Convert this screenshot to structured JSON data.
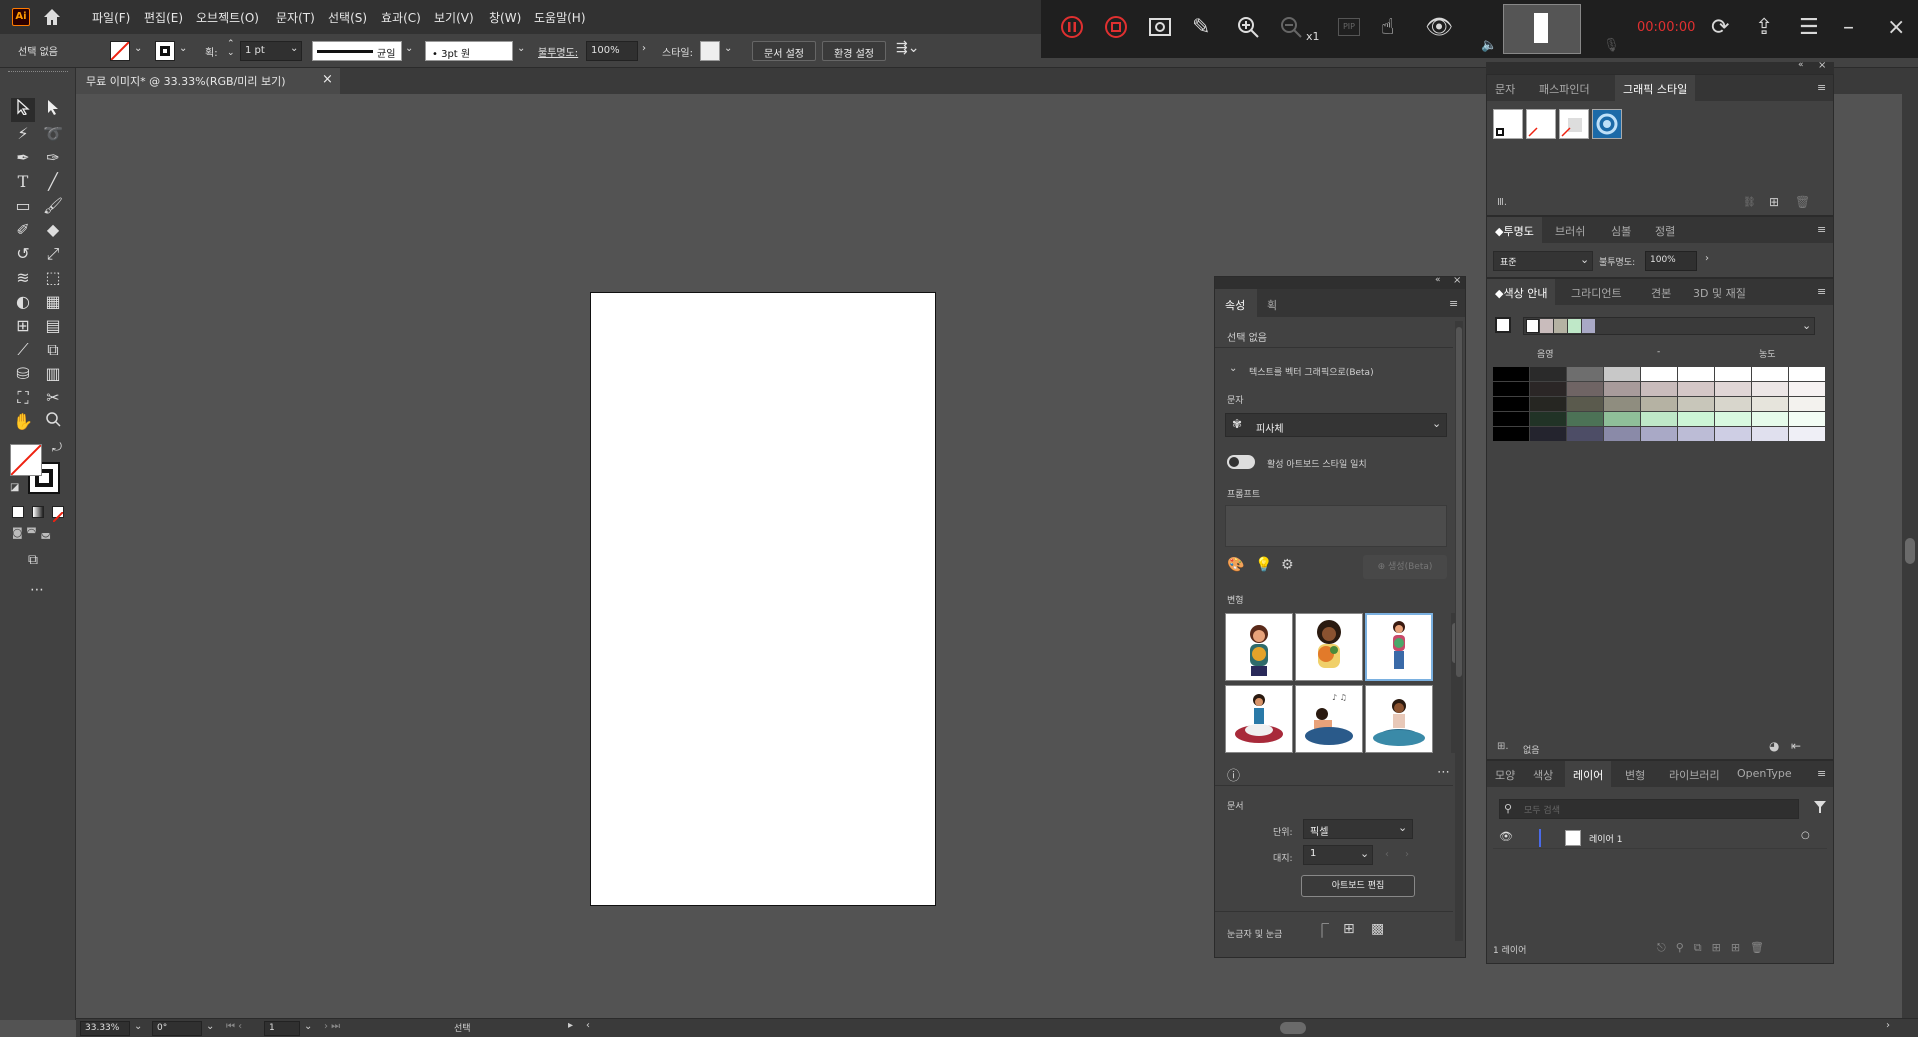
{
  "app": {
    "logo": "Ai",
    "home_icon": "home-icon"
  },
  "menu": [
    "파일(F)",
    "편집(E)",
    "오브젝트(O)",
    "문자(T)",
    "선택(S)",
    "효과(C)",
    "보기(V)",
    "창(W)",
    "도움말(H)"
  ],
  "control_bar": {
    "selection": "선택 없음",
    "stroke_label": "획:",
    "stroke_value": "1 pt",
    "stroke_profile": "균일",
    "brush": "3pt 원",
    "opacity_label": "불투명도:",
    "opacity_value": "100%",
    "style_label": "스타일:",
    "doc_setup": "문서 설정",
    "preferences": "환경 설정"
  },
  "recorder": {
    "timer": "00:00:00",
    "zoom": "x1",
    "pip": "PIP",
    "accent": "#e03030"
  },
  "document_tab": {
    "title": "무료 이미지* @ 33.33%(RGB/미리 보기)",
    "close": "×"
  },
  "properties_panel": {
    "tabs": [
      "속성",
      "획"
    ],
    "no_selection": "선택 없음",
    "section_title": "텍스트를 벡터 그래픽으로(Beta)",
    "type_label": "문자",
    "type_value": "피사체",
    "toggle_label": "활성 아트보드 스타일 일치",
    "prompt_label": "프롬프트",
    "generate_button": "생성(Beta)",
    "variations_label": "변형",
    "document_label": "문서",
    "units_label": "단위:",
    "units_value": "픽셀",
    "artboard_label": "대지:",
    "artboard_value": "1",
    "edit_artboard": "아트보드 편집",
    "rulers_label": "눈금자 및 눈금"
  },
  "graphic_styles_panel": {
    "tabs": [
      "문자",
      "패스파인더",
      "그래픽 스타일"
    ],
    "library_icon": "libraries-icon"
  },
  "transparency_panel": {
    "tabs": [
      "투명도",
      "브러쉬",
      "심볼",
      "정렬"
    ],
    "mode": "표준",
    "opacity_label": "불투명도:",
    "opacity_value": "100%"
  },
  "color_guide_panel": {
    "tabs": [
      "색상 안내",
      "그라디언트",
      "견본",
      "3D 및 재질"
    ],
    "col_labels": [
      "음영",
      "-",
      "농도"
    ],
    "footer_label": "없음",
    "grid": [
      [
        "#000000",
        "#2a2a2a",
        "#6e6e6e",
        "#c8c8c8",
        "#ffffff",
        "#ffffff",
        "#ffffff",
        "#ffffff",
        "#ffffff"
      ],
      [
        "#000000",
        "#2b2626",
        "#6f6464",
        "#a89b9b",
        "#c9bcbc",
        "#d4c7c7",
        "#e0d6d6",
        "#ece6e6",
        "#f6f2f2"
      ],
      [
        "#000000",
        "#262622",
        "#5a5a4d",
        "#8f8d7f",
        "#b5b2a3",
        "#c8c6ba",
        "#d8d6cc",
        "#e6e4dc",
        "#f3f2ee"
      ],
      [
        "#000000",
        "#213326",
        "#4c7256",
        "#8fbf99",
        "#bfe8c8",
        "#ccf5d6",
        "#d8f9e0",
        "#e6fbeb",
        "#f3fdf5"
      ],
      [
        "#000000",
        "#24242e",
        "#4d4d66",
        "#8a8aa8",
        "#a9a9c6",
        "#bcbcd6",
        "#ceceE4",
        "#e0e0ee",
        "#efeff6"
      ]
    ],
    "harmony": [
      "#ffffff",
      "#c9bcbc",
      "#b5b2a3",
      "#bfe8c8",
      "#a9a9c6"
    ]
  },
  "layers_panel": {
    "tabs": [
      "모양",
      "색상",
      "레이어",
      "변형",
      "라이브러리",
      "OpenType"
    ],
    "search_placeholder": "모두 검색",
    "layer_name": "레이어 1",
    "layer_count": "1 레이어"
  },
  "status_bar": {
    "zoom": "33.33%",
    "rotation": "0°",
    "page": "1",
    "tool": "선택"
  }
}
